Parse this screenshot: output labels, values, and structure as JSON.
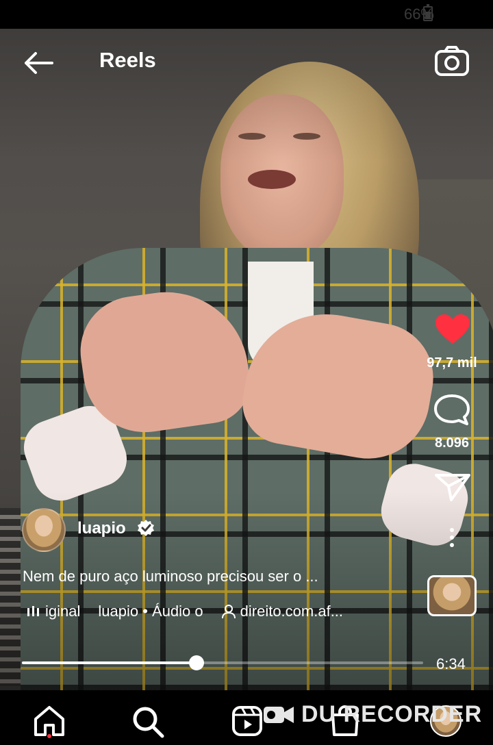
{
  "status_bar": {
    "battery": "66%"
  },
  "header": {
    "title": "Reels"
  },
  "reel": {
    "username": "luapio",
    "caption": "Nem de puro aço luminoso precisou ser o ...",
    "audio": {
      "segments": [
        "iginal",
        "luapio • Áudio o",
        "direito.com.af..."
      ]
    },
    "likes": "97,7 mil",
    "comments": "8.096",
    "duration": "6:34",
    "progress_fraction": 0.435,
    "liked": true
  },
  "watermark": "DU RECORDER",
  "colors": {
    "like": "#ff3040",
    "background": "#000000",
    "text": "#ffffff"
  },
  "icons": {
    "back": "arrow-left-icon",
    "camera": "camera-icon",
    "like": "heart-icon",
    "comment": "comment-icon",
    "share": "paper-plane-icon",
    "more": "more-vertical-icon",
    "verified": "verified-badge-icon",
    "nav": [
      "home-icon",
      "search-icon",
      "reels-icon",
      "shop-icon",
      "profile-avatar"
    ]
  }
}
